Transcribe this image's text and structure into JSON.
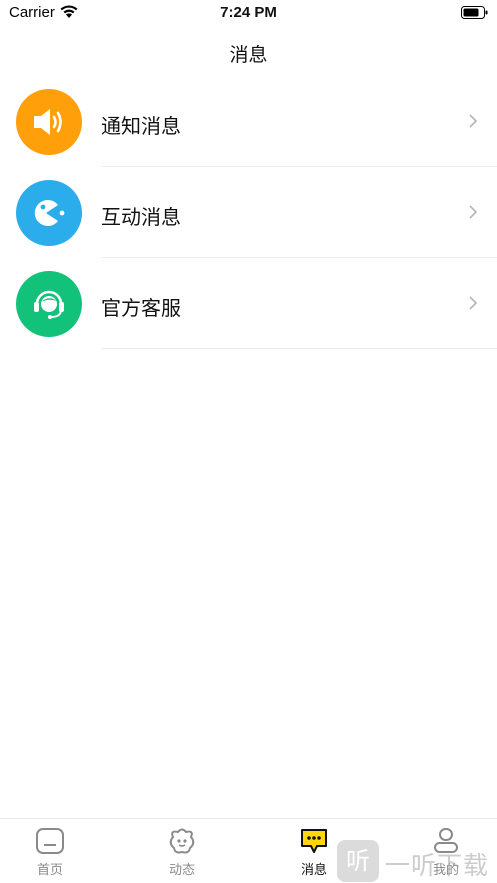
{
  "status_bar": {
    "carrier": "Carrier",
    "time": "7:24 PM"
  },
  "nav": {
    "title": "消息"
  },
  "messages": [
    {
      "label": "通知消息",
      "icon": "speaker-icon",
      "color": "#FF9F0A"
    },
    {
      "label": "互动消息",
      "icon": "pacman-icon",
      "color": "#2AADEA"
    },
    {
      "label": "官方客服",
      "icon": "headset-agent-icon",
      "color": "#13C27A"
    }
  ],
  "tabs": [
    {
      "label": "首页",
      "icon": "home-icon",
      "active": false
    },
    {
      "label": "动态",
      "icon": "moments-icon",
      "active": false
    },
    {
      "label": "消息",
      "icon": "chat-icon",
      "active": true
    },
    {
      "label": "我的",
      "icon": "profile-icon",
      "active": false
    }
  ],
  "colors": {
    "accent": "#FFD60A",
    "inactive": "#8A8A8A"
  },
  "watermark": {
    "badge": "听",
    "text": "一听下载"
  }
}
